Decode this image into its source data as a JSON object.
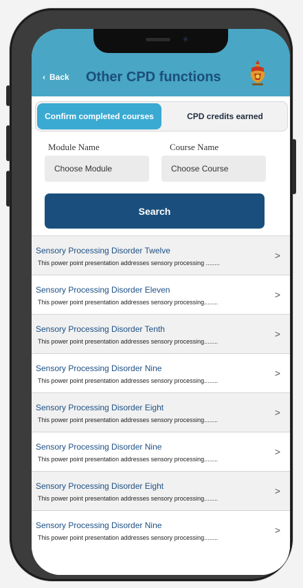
{
  "header": {
    "back_label": "Back",
    "title": "Other CPD functions"
  },
  "tabs": [
    {
      "label": "Confirm completed courses",
      "active": true
    },
    {
      "label": "CPD credits earned",
      "active": false
    }
  ],
  "filters": {
    "module": {
      "label": "Module Name",
      "value": "Choose Module"
    },
    "course": {
      "label": "Course Name",
      "value": "Choose Course"
    }
  },
  "search_label": "Search",
  "items": [
    {
      "title": "Sensory Processing Disorder Twelve",
      "desc": "This power point presentation addresses sensory processing ........",
      "chev": ">"
    },
    {
      "title": "Sensory Processing Disorder Eleven",
      "desc": "This power point presentation addresses sensory processing........",
      "chev": ">"
    },
    {
      "title": "Sensory Processing Disorder Tenth",
      "desc": "This power point presentation addresses sensory processing........",
      "chev": ">"
    },
    {
      "title": "Sensory Processing Disorder Nine",
      "desc": "This power point presentation addresses sensory processing........",
      "chev": ">"
    },
    {
      "title": "Sensory Processing Disorder Eight",
      "desc": "This power point presentation addresses sensory processing........",
      "chev": ">"
    },
    {
      "title": "Sensory Processing Disorder Nine",
      "desc": "This power point presentation addresses sensory processing........",
      "chev": ">"
    },
    {
      "title": "Sensory Processing Disorder Eight",
      "desc": "This power point presentation addresses sensory processing........",
      "chev": ">"
    },
    {
      "title": "Sensory Processing Disorder Nine",
      "desc": "This power point presentation addresses sensory processing........",
      "chev": ">"
    }
  ],
  "icons": {
    "back": "chevron-left-icon",
    "logo": "crest-logo-icon",
    "row": "chevron-right-icon"
  },
  "colors": {
    "header": "#49a6c4",
    "title": "#1b4f7a",
    "active_tab": "#3aaad2",
    "search_button": "#1a4f7d",
    "item_title": "#1c4f84"
  }
}
